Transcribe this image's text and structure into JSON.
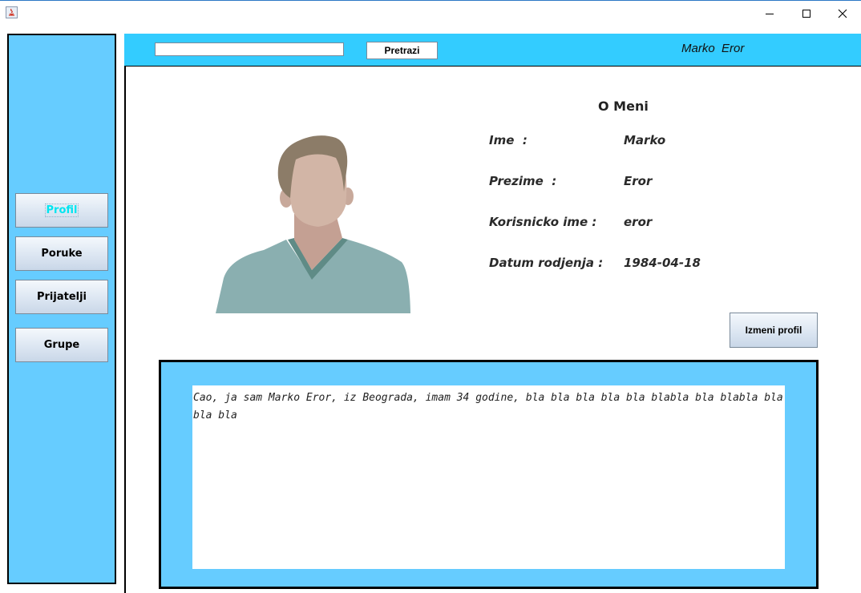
{
  "window": {
    "controls": {
      "minimize_icon": "minimize-icon",
      "maximize_icon": "maximize-icon",
      "close_icon": "close-icon"
    }
  },
  "sidebar": {
    "items": [
      {
        "label": "Profil",
        "active": true
      },
      {
        "label": "Poruke"
      },
      {
        "label": "Prijatelji"
      },
      {
        "label": "Grupe"
      }
    ]
  },
  "topbar": {
    "search_value": "",
    "search_button": "Pretrazi",
    "user_name": "Marko  Eror"
  },
  "profile": {
    "title": "O Meni",
    "fields": [
      {
        "label": "Ime  :",
        "value": "Marko"
      },
      {
        "label": "Prezime  :",
        "value": "Eror"
      },
      {
        "label": "Korisnicko ime :",
        "value": "eror"
      },
      {
        "label": "Datum rodjenja :",
        "value": "1984-04-18"
      }
    ],
    "edit_button": "Izmeni profil",
    "bio": "Cao, ja sam Marko Eror, iz Beograda, imam 34 godine, bla bla bla bla bla blabla bla blabla bla bla bla"
  },
  "colors": {
    "sidebar_bg": "#66ccff",
    "topbar_bg": "#33ccff",
    "active_label": "#00e5f0"
  }
}
